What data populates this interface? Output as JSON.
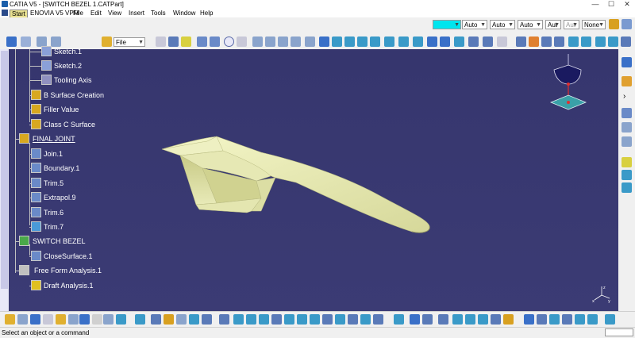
{
  "window": {
    "title": "CATIA V5 - [SWITCH BEZEL 1.CATPart]",
    "minimize": "—",
    "maximize": "☐",
    "close": "✕"
  },
  "menu": {
    "items": [
      "Start",
      "ENOVIA V5 VPM",
      "File",
      "Edit",
      "View",
      "Insert",
      "Tools",
      "Window",
      "Help"
    ]
  },
  "toolbar_top": {
    "file_combo": "File",
    "color_combo": "",
    "combos": [
      "Auto",
      "Auto",
      "Auto",
      "Aut",
      "Aut",
      "None"
    ]
  },
  "tree": {
    "items": [
      {
        "label": "Sketch.1",
        "icon": "sketch-icon"
      },
      {
        "label": "Sketch.2",
        "icon": "sketch-icon"
      },
      {
        "label": "Tooling Axis",
        "icon": "axis-icon"
      },
      {
        "label": "B Surface Creation",
        "icon": "geometrical-set-icon"
      },
      {
        "label": "Filler Value",
        "icon": "fill-icon"
      },
      {
        "label": "Class C Surface",
        "icon": "geometrical-set-icon"
      },
      {
        "label": "FINAL JOINT",
        "icon": "geometrical-set-icon"
      },
      {
        "label": "Join.1",
        "icon": "join-icon"
      },
      {
        "label": "Boundary.1",
        "icon": "boundary-icon"
      },
      {
        "label": "Trim.5",
        "icon": "trim-icon"
      },
      {
        "label": "Extrapol.9",
        "icon": "extrapolate-icon"
      },
      {
        "label": "Trim.6",
        "icon": "trim-icon"
      },
      {
        "label": "Trim.7",
        "icon": "trim-icon"
      },
      {
        "label": "SWITCH BEZEL",
        "icon": "part-body-icon"
      },
      {
        "label": "CloseSurface.1",
        "icon": "close-surface-icon"
      },
      {
        "label": "Free Form Analysis.1",
        "icon": "analysis-icon"
      },
      {
        "label": "Draft Analysis.1",
        "icon": "draft-analysis-icon"
      }
    ]
  },
  "status": {
    "message": "Select an object or a command"
  },
  "colors": {
    "viewport_bg": "#3a3a72",
    "part_fill": "#e6e8b0",
    "accent_cyan": "#00e5ee"
  }
}
